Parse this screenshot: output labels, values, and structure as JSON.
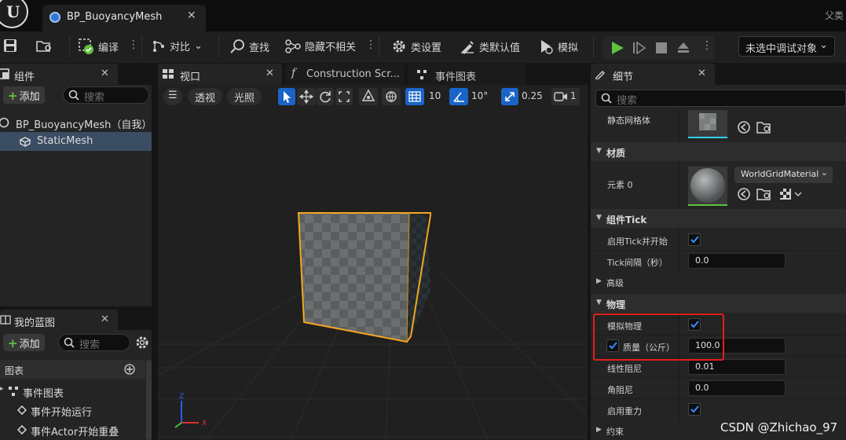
{
  "title_bar": {
    "logo_letter": "U",
    "doc_tab_title": "BP_BuoyancyMesh",
    "doc_tab_close": "✕",
    "parent_class_label": "父类"
  },
  "toolbar": {
    "compile_label": "编译",
    "diff_label": "对比",
    "find_label": "查找",
    "hide_unrelated_label": "隐藏不相关",
    "class_settings_label": "类设置",
    "class_defaults_label": "类默认值",
    "simulate_label": "模拟",
    "debug_object_label": "未选中调试对象"
  },
  "components_panel": {
    "tab_title": "组件",
    "add_label": "添加",
    "search_placeholder": "搜索",
    "root_item": "BP_BuoyancyMesh（自我）",
    "child_item": "StaticMesh"
  },
  "my_blueprint_panel": {
    "tab_title": "我的蓝图",
    "add_label": "添加",
    "search_placeholder": "搜索",
    "graphs_header": "图表",
    "event_graph": "事件图表",
    "items": [
      "事件开始运行",
      "事件Actor开始重叠"
    ]
  },
  "center_tabs": {
    "viewport": "视口",
    "construction_script": "Construction Scr...",
    "event_graph": "事件图表"
  },
  "viewport_toolbar": {
    "perspective": "透视",
    "lit": "光照",
    "grid_snap": "10",
    "rotation_snap": "10°",
    "scale_snap": "0.25",
    "camera_speed": "1"
  },
  "details_panel": {
    "tab_title": "细节",
    "search_placeholder": "搜索",
    "static_mesh_label": "静态网格体",
    "materials_header": "材质",
    "element0_label": "元素 0",
    "material_name": "WorldGridMaterial",
    "component_tick_header": "组件Tick",
    "start_with_tick_label": "启用Tick并开始",
    "start_with_tick_checked": true,
    "tick_interval_label": "Tick间隔（秒）",
    "tick_interval_value": "0.0",
    "advanced_header": "高级",
    "physics_header": "物理",
    "simulate_physics_label": "模拟物理",
    "simulate_physics_checked": true,
    "mass_label": "质量（公斤）",
    "mass_override_checked": true,
    "mass_value": "100.0",
    "linear_damping_label": "线性阻尼",
    "linear_damping_value": "0.01",
    "angular_damping_label": "角阻尼",
    "angular_damping_value": "0.0",
    "enable_gravity_label": "启用重力",
    "enable_gravity_checked": true,
    "constraints_header": "约束"
  },
  "colors": {
    "accent_blue": "#1a64c8",
    "selection": "#3a4d63",
    "highlight_red": "#e0201a",
    "cube_outline": "#f5a623",
    "play_green": "#5fc33f"
  },
  "watermark": "CSDN @Zhichao_97"
}
